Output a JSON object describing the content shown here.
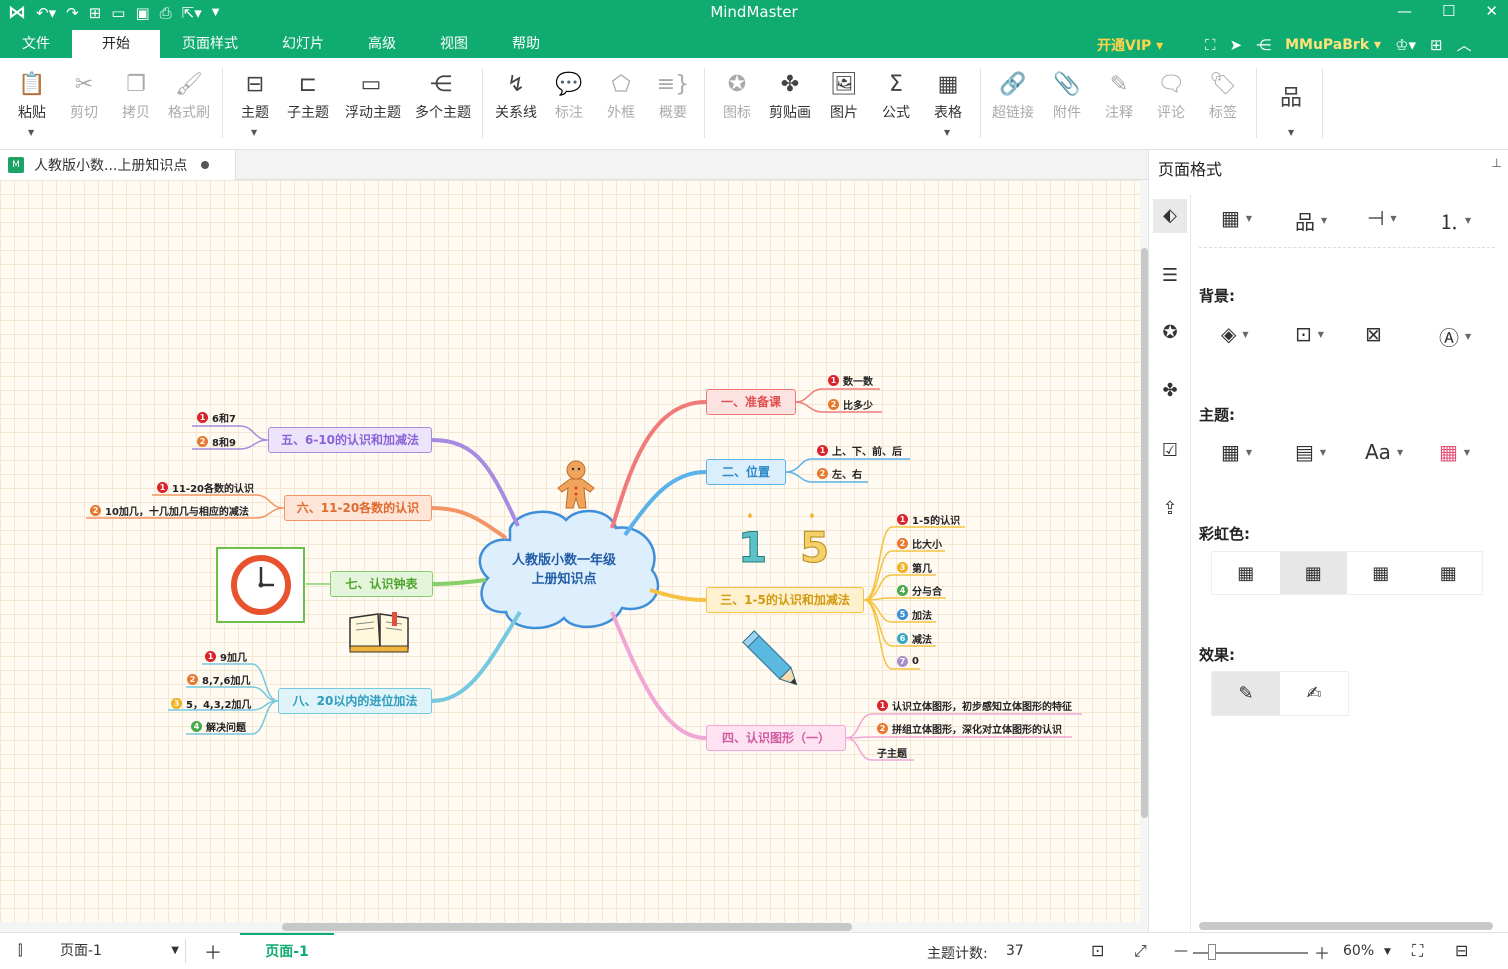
{
  "app": {
    "title": "MindMaster"
  },
  "menu": [
    "文件",
    "开始",
    "页面样式",
    "幻灯片",
    "高级",
    "视图",
    "帮助"
  ],
  "menu_active": "开始",
  "vip_label": "开通VIP",
  "user_name": "MMuPaBrk",
  "ribbon": {
    "paste": "粘贴",
    "cut": "剪切",
    "copy": "拷贝",
    "format_painter": "格式刷",
    "topic": "主题",
    "subtopic": "子主题",
    "floating_topic": "浮动主题",
    "multiple_topics": "多个主题",
    "relationship": "关系线",
    "callout": "标注",
    "boundary": "外框",
    "summary": "概要",
    "icon": "图标",
    "clipart": "剪贴画",
    "picture": "图片",
    "formula": "公式",
    "table": "表格",
    "hyperlink": "超链接",
    "attachment": "附件",
    "note": "注释",
    "comment": "评论",
    "tag": "标签"
  },
  "doc_tab": {
    "name": "人教版小数...上册知识点"
  },
  "mindmap": {
    "central": [
      "人教版小数一年级",
      "上册知识点"
    ],
    "branches": {
      "b1": {
        "label": "一、准备课",
        "subs": [
          "数一数",
          "比多少"
        ]
      },
      "b2": {
        "label": "二、位置",
        "subs": [
          "上、下、前、后",
          "左、右"
        ]
      },
      "b3": {
        "label": "三、1-5的认识和加减法",
        "subs": [
          "1-5的认识",
          "比大小",
          "第几",
          "分与合",
          "加法",
          "减法",
          "0"
        ]
      },
      "b4": {
        "label": "四、认识图形（一）",
        "subs": [
          "认识立体图形，初步感知立体图形的特征",
          "拼组立体图形，深化对立体图形的认识",
          "子主题"
        ]
      },
      "b5": {
        "label": "五、6-10的认识和加减法",
        "subs": [
          "6和7",
          "8和9"
        ]
      },
      "b6": {
        "label": "六、11-20各数的认识",
        "subs": [
          "11-20各数的认识",
          "10加几，十几加几与相应的减法"
        ]
      },
      "b7": {
        "label": "七、认识钟表"
      },
      "b8": {
        "label": "八、20以内的进位加法",
        "subs": [
          "9加几",
          "8,7,6加几",
          "5，4,3,2加几",
          "解决问题"
        ]
      }
    },
    "candle_digits": [
      "1",
      "5"
    ]
  },
  "panel": {
    "title": "页面格式",
    "background": "背景:",
    "theme": "主题:",
    "theme_font": "Aa",
    "rainbow": "彩虹色:",
    "effect": "效果:"
  },
  "status": {
    "page_select": "页面-1",
    "page_tab": "页面-1",
    "topic_count_label": "主题计数:",
    "topic_count": "37",
    "zoom": "60%"
  },
  "colors": {
    "brand": "#10ab71",
    "vip": "#ffd34a"
  }
}
